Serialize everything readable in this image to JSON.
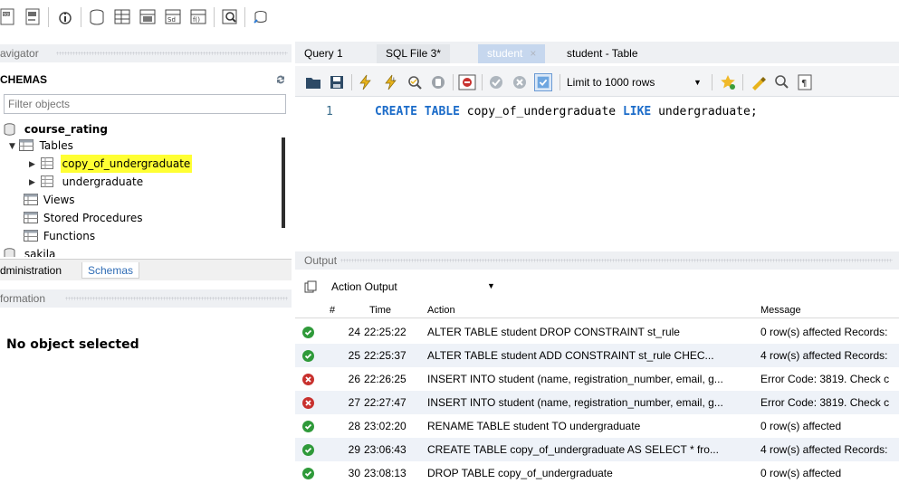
{
  "navigator": {
    "header": "avigator",
    "schemas_label": "CHEMAS",
    "filter_placeholder": "Filter objects",
    "tree": {
      "schema": "course_rating",
      "tables_label": "Tables",
      "tables": [
        "copy_of_undergraduate",
        "undergraduate"
      ],
      "views": "Views",
      "procedures": "Stored Procedures",
      "functions": "Functions",
      "next_schema": "sakila"
    },
    "tabs": [
      "dministration",
      "Schemas"
    ],
    "info_header": "formation",
    "no_object": "No object selected"
  },
  "tabs": [
    {
      "label": "Query 1"
    },
    {
      "label": "SQL File 3*"
    },
    {
      "label": "student"
    },
    {
      "label": "student - Table"
    }
  ],
  "sql_toolbar": {
    "limit": "Limit to 1000 rows"
  },
  "editor": {
    "line_number": "1",
    "keyword": "CREATE TABLE",
    "rest": " copy_of_undergraduate ",
    "keyword2": "LIKE",
    "rest2": " undergraduate;"
  },
  "output": {
    "header": "Output",
    "mode": "Action Output",
    "columns": {
      "num": "#",
      "time": "Time",
      "action": "Action",
      "message": "Message"
    },
    "rows": [
      {
        "status": "ok",
        "num": "24",
        "time": "22:25:22",
        "action": "ALTER TABLE student DROP CONSTRAINT st_rule",
        "message": "0 row(s) affected Records:"
      },
      {
        "status": "ok",
        "num": "25",
        "time": "22:25:37",
        "action": "ALTER TABLE student ADD CONSTRAINT st_rule CHEC...",
        "message": "4 row(s) affected Records:"
      },
      {
        "status": "err",
        "num": "26",
        "time": "22:26:25",
        "action": "INSERT INTO student (name, registration_number, email, g...",
        "message": "Error Code: 3819. Check c"
      },
      {
        "status": "err",
        "num": "27",
        "time": "22:27:47",
        "action": "INSERT INTO student (name, registration_number, email, g...",
        "message": "Error Code: 3819. Check c"
      },
      {
        "status": "ok",
        "num": "28",
        "time": "23:02:20",
        "action": "RENAME TABLE student TO undergraduate",
        "message": "0 row(s) affected"
      },
      {
        "status": "ok",
        "num": "29",
        "time": "23:06:43",
        "action": "CREATE TABLE copy_of_undergraduate AS SELECT * fro...",
        "message": "4 row(s) affected Records:"
      },
      {
        "status": "ok",
        "num": "30",
        "time": "23:08:13",
        "action": "DROP TABLE copy_of_undergraduate",
        "message": "0 row(s) affected"
      }
    ]
  },
  "colors": {
    "ok": "#2f9a3a",
    "error": "#c8312e",
    "keyword": "#1c6cc9",
    "highlight": "#ffff33"
  }
}
